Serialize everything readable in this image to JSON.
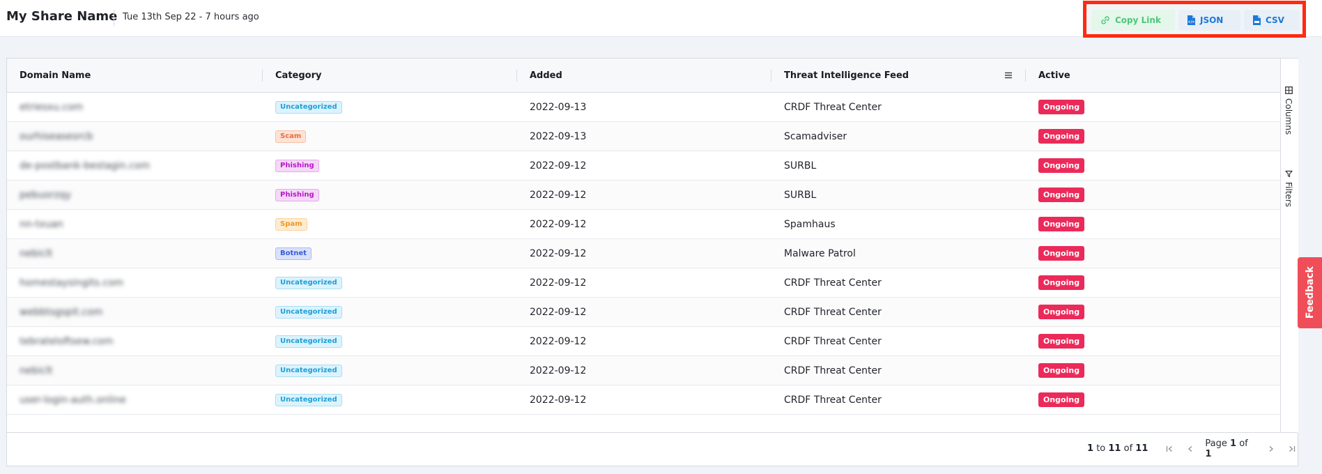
{
  "header": {
    "title": "My Share Name",
    "date": "Tue 13th Sep 22 - 7 hours ago"
  },
  "actions": {
    "copy_link": "Copy Link",
    "json": "JSON",
    "csv": "CSV"
  },
  "table": {
    "columns": [
      "Domain Name",
      "Category",
      "Added",
      "Threat Intelligence Feed",
      "Active"
    ],
    "rows": [
      {
        "domain": "etriesxu.com",
        "category": "Uncategorized",
        "added": "2022-09-13",
        "feed": "CRDF Threat Center",
        "active": "Ongoing"
      },
      {
        "domain": "ourhiseasesrcb",
        "category": "Scam",
        "added": "2022-09-13",
        "feed": "Scamadviser",
        "active": "Ongoing"
      },
      {
        "domain": "de-postbank-bestagin.com",
        "category": "Phishing",
        "added": "2022-09-12",
        "feed": "SURBL",
        "active": "Ongoing"
      },
      {
        "domain": "pebuorzqy",
        "category": "Phishing",
        "added": "2022-09-12",
        "feed": "SURBL",
        "active": "Ongoing"
      },
      {
        "domain": "nn-txuan",
        "category": "Spam",
        "added": "2022-09-12",
        "feed": "Spamhaus",
        "active": "Ongoing"
      },
      {
        "domain": "nebiclt",
        "category": "Botnet",
        "added": "2022-09-12",
        "feed": "Malware Patrol",
        "active": "Ongoing"
      },
      {
        "domain": "homestaysingits.com",
        "category": "Uncategorized",
        "added": "2022-09-12",
        "feed": "CRDF Threat Center",
        "active": "Ongoing"
      },
      {
        "domain": "webbtsgspit.com",
        "category": "Uncategorized",
        "added": "2022-09-12",
        "feed": "CRDF Threat Center",
        "active": "Ongoing"
      },
      {
        "domain": "tebrateloftsew.com",
        "category": "Uncategorized",
        "added": "2022-09-12",
        "feed": "CRDF Threat Center",
        "active": "Ongoing"
      },
      {
        "domain": "nebiclt",
        "category": "Uncategorized",
        "added": "2022-09-12",
        "feed": "CRDF Threat Center",
        "active": "Ongoing"
      },
      {
        "domain": "user-login-auth.online",
        "category": "Uncategorized",
        "added": "2022-09-12",
        "feed": "CRDF Threat Center",
        "active": "Ongoing"
      }
    ]
  },
  "side_panel": {
    "columns": "Columns",
    "filters": "Filters"
  },
  "footer": {
    "range_start": "1",
    "range_to": "to",
    "range_end": "11",
    "range_of": "of",
    "range_total": "11",
    "page_label": "Page",
    "page_current": "1",
    "page_of": "of",
    "page_total": "1"
  },
  "feedback": "Feedback",
  "colors": {
    "highlight_border": "#ff2a12",
    "ongoing": "#ec2a5a",
    "feedback": "#ef4e58",
    "copy_link": "#4cc77a",
    "export": "#1c78d8"
  }
}
